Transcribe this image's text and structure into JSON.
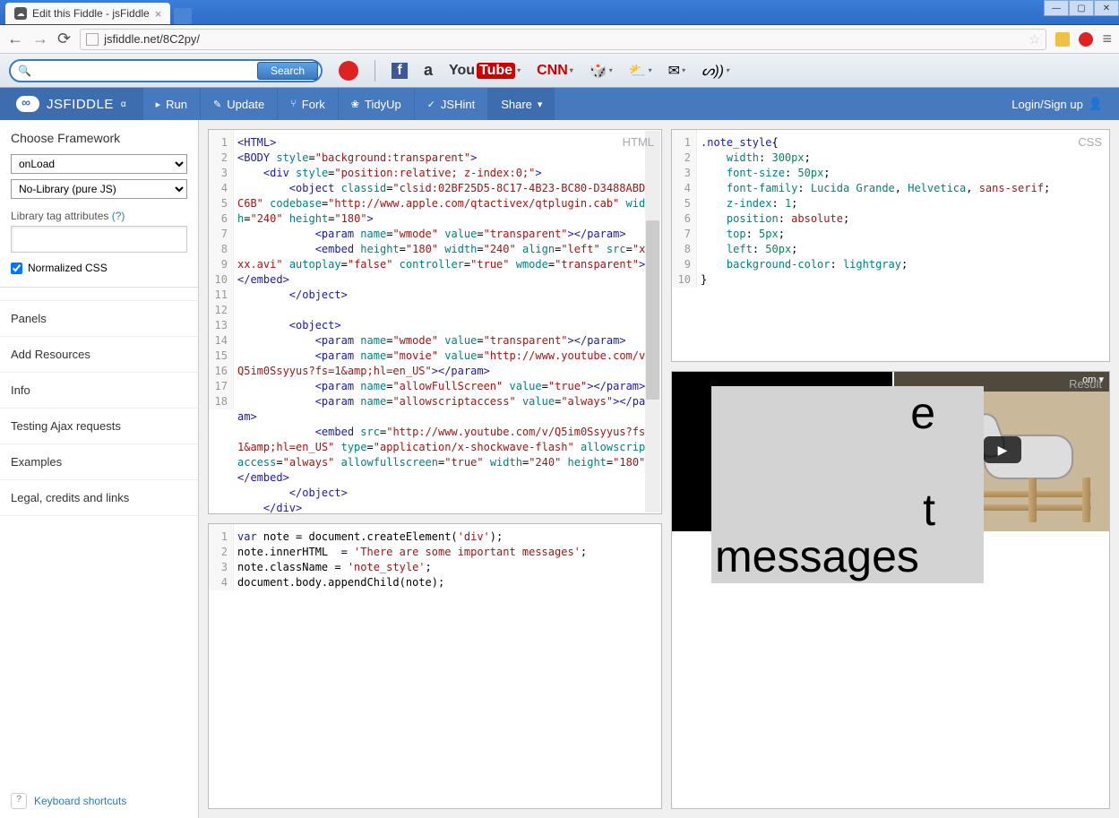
{
  "browser": {
    "tab_title": "Edit this Fiddle - jsFiddle",
    "url": "jsfiddle.net/8C2py/",
    "search_btn": "Search"
  },
  "jsfiddle": {
    "brand": "JSFIDDLE",
    "alpha": "α",
    "run": "Run",
    "update": "Update",
    "fork": "Fork",
    "tidy": "TidyUp",
    "jshint": "JSHint",
    "share": "Share",
    "login": "Login/Sign up"
  },
  "sidebar": {
    "title": "Choose Framework",
    "onload": "onLoad",
    "nolibrary": "No-Library (pure JS)",
    "libattrs": "Library tag attributes",
    "help": "(?)",
    "normalized": "Normalized CSS",
    "panels": "Panels",
    "add_resources": "Add Resources",
    "info": "Info",
    "testing": "Testing Ajax requests",
    "examples": "Examples",
    "legal": "Legal, credits and links",
    "kb_shortcuts": "Keyboard shortcuts"
  },
  "labels": {
    "html": "HTML",
    "css": "CSS",
    "result": "Result"
  },
  "html_lines": [
    "1",
    "2",
    "3",
    "4",
    "5",
    "6",
    "7",
    "8",
    "9",
    "10",
    "11",
    "12",
    "13",
    "14",
    "15",
    "16",
    "17",
    "18"
  ],
  "css_lines": [
    "1",
    "2",
    "3",
    "4",
    "5",
    "6",
    "7",
    "8",
    "9",
    "10"
  ],
  "js_lines": [
    "1",
    "2",
    "3",
    "4"
  ],
  "result": {
    "msg_text_1": "e",
    "msg_text_2": "t",
    "msg_text_3": "messages",
    "yt_menu": "om"
  },
  "css_code": {
    "sel": ".note_style",
    "p1": "width",
    "v1": "300px",
    "p2": "font-size",
    "v2": "50px",
    "p3": "font-family",
    "v3a": "Lucida Grande",
    "v3b": "Helvetica",
    "v3c": "sans-serif",
    "p4": "z-index",
    "v4": "1",
    "p5": "position",
    "v5": "absolute",
    "p6": "top",
    "v6": "5px",
    "p7": "left",
    "v7": "50px",
    "p8": "background-color",
    "v8": "lightgray"
  },
  "js_code": {
    "l1a": "var",
    "l1b": " note = document.createElement(",
    "l1c": "'div'",
    "l1d": ");",
    "l2a": "note.innerHTML  = ",
    "l2b": "'There are some important messages'",
    "l2c": ";",
    "l3a": "note.className = ",
    "l3b": "'note_style'",
    "l3c": ";",
    "l4": "document.body.appendChild(note);"
  }
}
